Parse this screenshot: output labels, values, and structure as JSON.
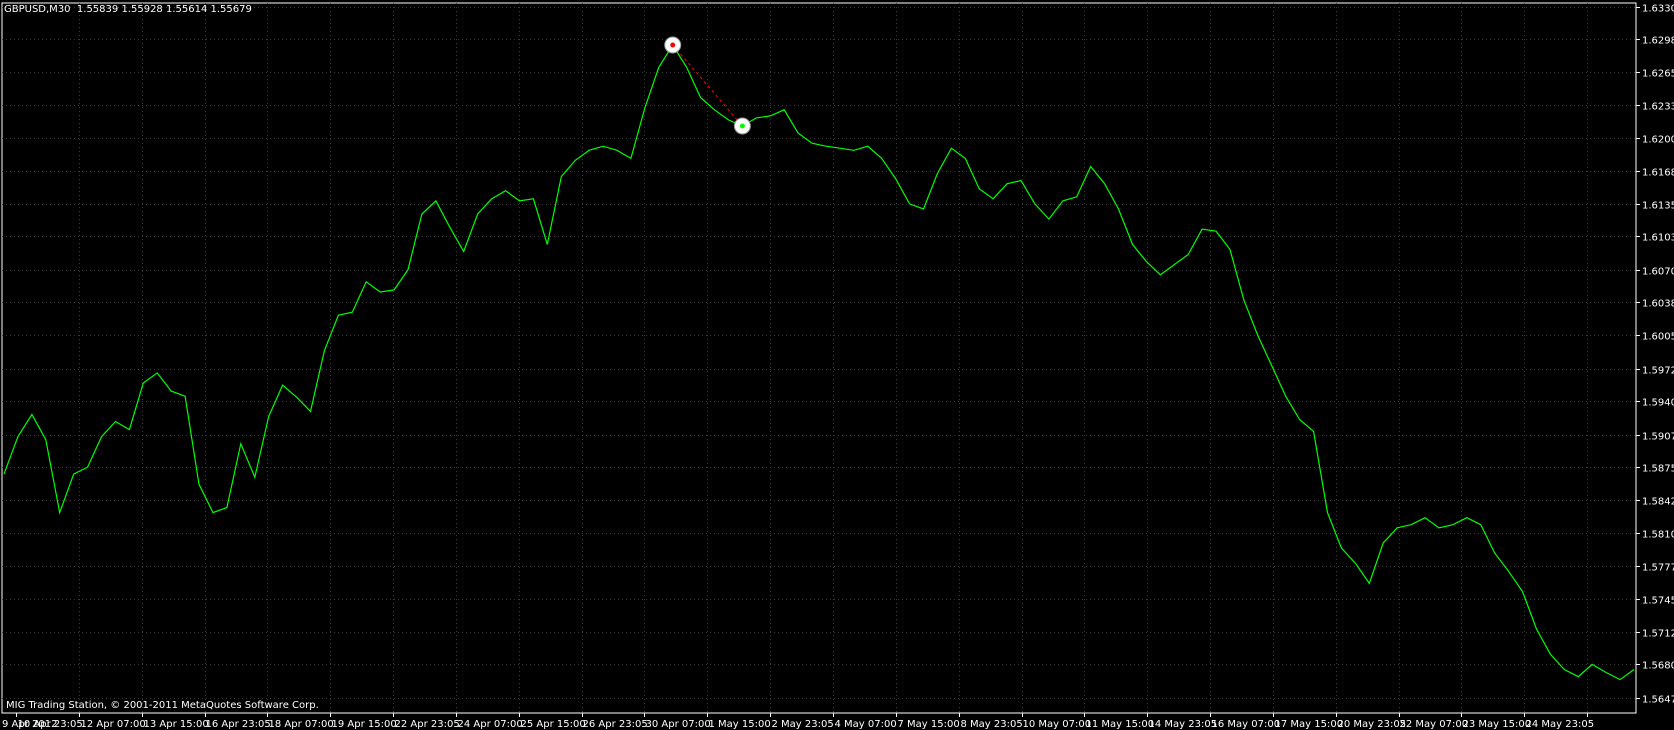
{
  "header": {
    "symbol": "GBPUSD,M30",
    "quote": "1.55839 1.55928 1.55614 1.55679"
  },
  "copyright": "MIG Trading Station, © 2001-2011 MetaQuotes Software Corp.",
  "colors": {
    "background": "#000000",
    "price_line": "#00ff00",
    "axis": "#ffffff",
    "grid": "#3a3a3a",
    "trade_line": "#ff0000",
    "trade_marker": "#ffffff"
  },
  "chart_data": {
    "type": "line",
    "title": "GBPUSD,M30",
    "grid": true,
    "grid_style": "dotted",
    "y_axis_side": "right",
    "ylim": [
      1.5632,
      1.63335
    ],
    "y_ticks": [
      "1.63300",
      "1.62980",
      "1.62650",
      "1.62330",
      "1.62000",
      "1.61680",
      "1.61350",
      "1.61030",
      "1.60700",
      "1.60380",
      "1.60050",
      "1.59720",
      "1.59400",
      "1.59070",
      "1.58750",
      "1.58420",
      "1.58100",
      "1.57770",
      "1.57450",
      "1.57120",
      "1.56800",
      "1.56470"
    ],
    "x_ticks": [
      "9 Apr 2012",
      "10 Apr 23:05",
      "12 Apr 07:00",
      "13 Apr 15:00",
      "16 Apr 23:05",
      "18 Apr 07:00",
      "19 Apr 15:00",
      "22 Apr 23:05",
      "24 Apr 07:00",
      "25 Apr 15:00",
      "26 Apr 23:05",
      "30 Apr 07:00",
      "1 May 15:00",
      "2 May 23:05",
      "4 May 07:00",
      "7 May 15:00",
      "8 May 23:05",
      "10 May 07:00",
      "11 May 15:00",
      "14 May 23:05",
      "16 May 07:00",
      "17 May 15:00",
      "20 May 23:05",
      "22 May 07:00",
      "23 May 15:00",
      "24 May 23:05"
    ],
    "series": [
      {
        "values": [
          1.5868,
          1.5905,
          1.5927,
          1.5902,
          1.583,
          1.5868,
          1.5875,
          1.5905,
          1.592,
          1.5912,
          1.5958,
          1.5968,
          1.595,
          1.5945,
          1.5858,
          1.583,
          1.5835,
          1.5898,
          1.5865,
          1.5925,
          1.5956,
          1.5944,
          1.593,
          1.599,
          1.6025,
          1.6028,
          1.6058,
          1.6048,
          1.605,
          1.607,
          1.6125,
          1.6138,
          1.6112,
          1.6088,
          1.6125,
          1.614,
          1.6148,
          1.6138,
          1.614,
          1.6095,
          1.6162,
          1.6178,
          1.6188,
          1.6192,
          1.6188,
          1.618,
          1.623,
          1.627,
          1.6292,
          1.627,
          1.624,
          1.6228,
          1.6218,
          1.6212,
          1.622,
          1.6222,
          1.6228,
          1.6205,
          1.6195,
          1.6192,
          1.619,
          1.6188,
          1.6192,
          1.618,
          1.616,
          1.6135,
          1.613,
          1.6165,
          1.619,
          1.618,
          1.615,
          1.614,
          1.6155,
          1.6158,
          1.6135,
          1.612,
          1.6138,
          1.6142,
          1.6172,
          1.6155,
          1.613,
          1.6095,
          1.6078,
          1.6065,
          1.6075,
          1.6085,
          1.611,
          1.6108,
          1.609,
          1.604,
          1.6005,
          1.5975,
          1.5945,
          1.5922,
          1.591,
          1.583,
          1.5795,
          1.578,
          1.576,
          1.58,
          1.5815,
          1.5818,
          1.5825,
          1.5815,
          1.5818,
          1.5825,
          1.5818,
          1.579,
          1.5772,
          1.5752,
          1.5715,
          1.569,
          1.5675,
          1.5668,
          1.568,
          1.5672,
          1.5665,
          1.5675
        ]
      }
    ],
    "trade": {
      "entry": {
        "bar": 48,
        "price": 1.6292
      },
      "exit": {
        "bar": 53,
        "price": 1.6212
      }
    }
  }
}
